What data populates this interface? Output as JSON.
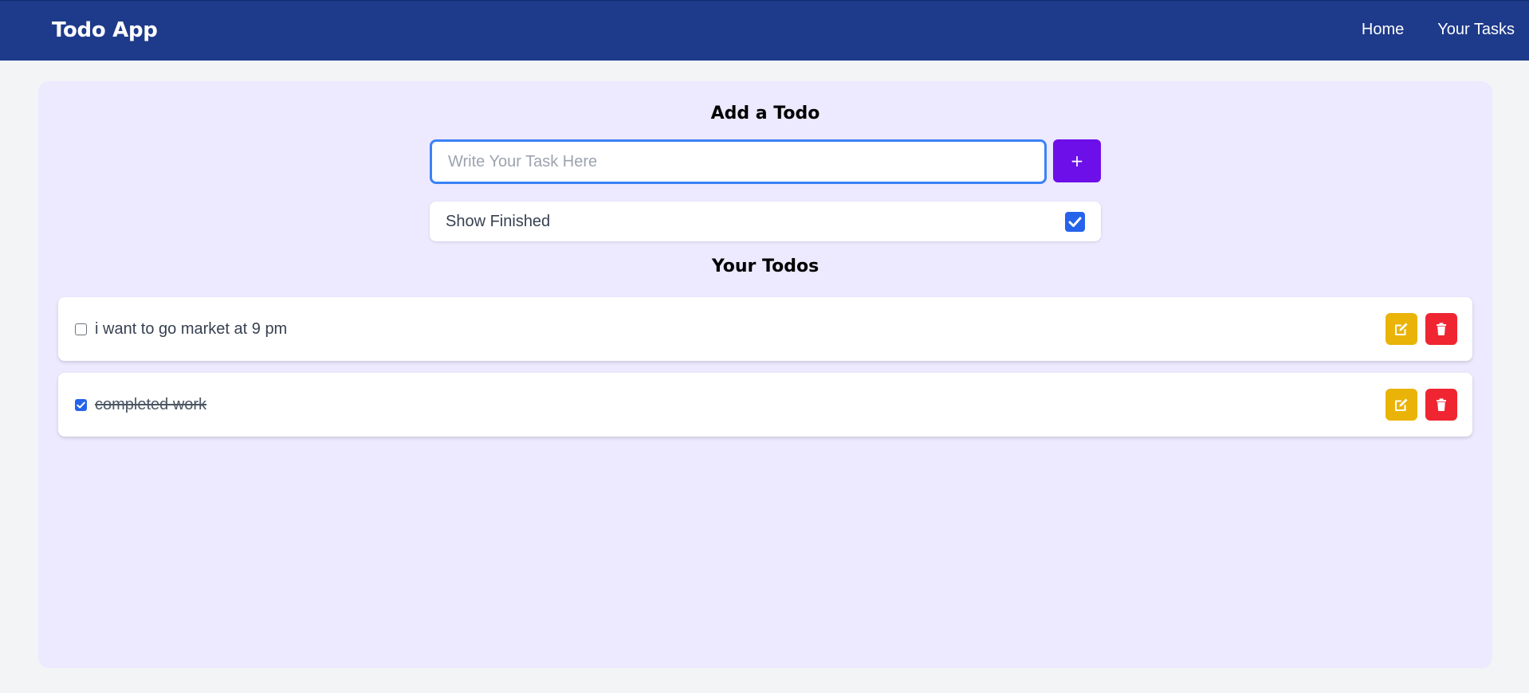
{
  "navbar": {
    "brand": "Todo App",
    "links": [
      "Home",
      "Your Tasks"
    ]
  },
  "add_section": {
    "title": "Add a Todo",
    "input_placeholder": "Write Your Task Here",
    "input_value": "",
    "add_button_label": "+"
  },
  "filter": {
    "label": "Show Finished",
    "checked": true
  },
  "todos_section": {
    "title": "Your Todos",
    "items": [
      {
        "text": "i want to go market at 9 pm",
        "done": false
      },
      {
        "text": "completed work",
        "done": true
      }
    ]
  },
  "colors": {
    "navbar": "#1e3a8a",
    "panel": "#ede9fe",
    "add_button": "#6d0fe8",
    "edit_button": "#eab308",
    "delete_button": "#ef2631",
    "checkbox_accent": "#2563eb"
  },
  "icons": {
    "edit": "edit-icon",
    "delete": "trash-icon",
    "checkmark": "checkmark-icon"
  }
}
